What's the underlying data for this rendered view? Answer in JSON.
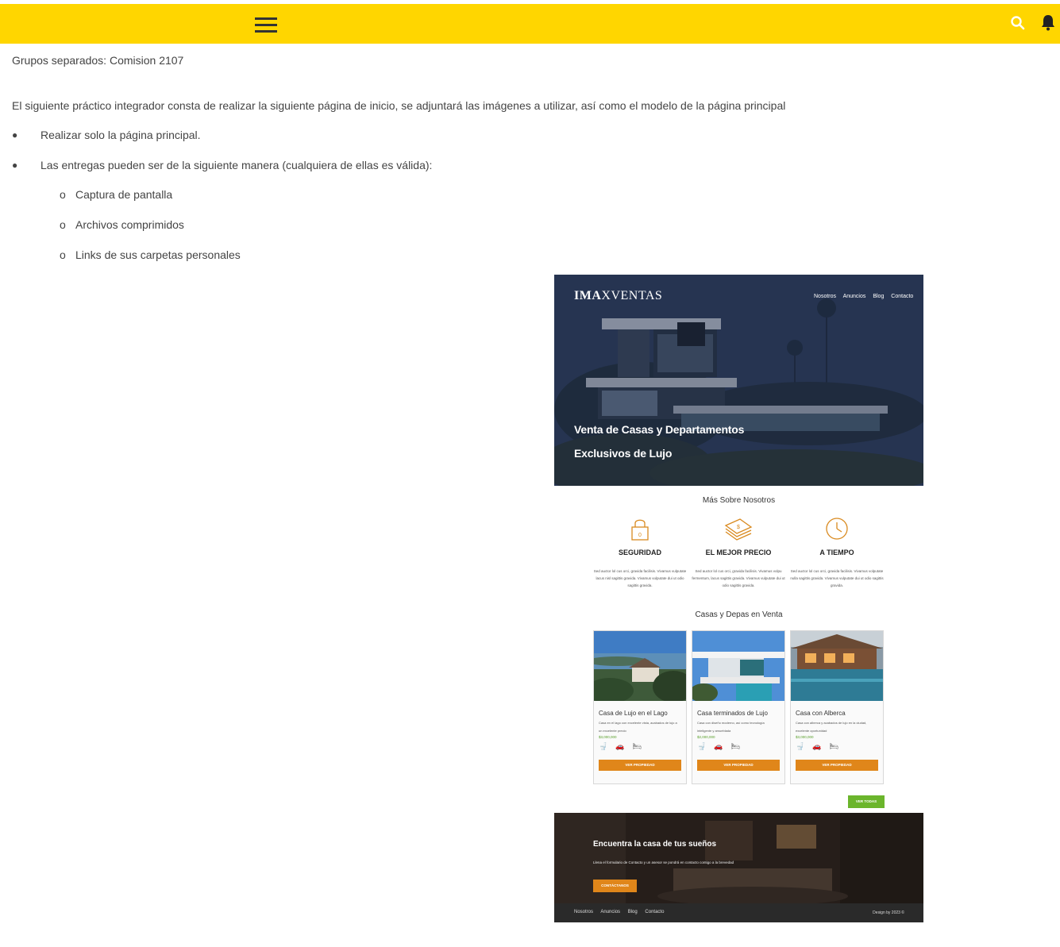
{
  "toolbar": {
    "menu_icon": "hamburger-menu-icon",
    "search_icon": "search-icon",
    "bell_icon": "bell-icon",
    "accent": "#ffd600"
  },
  "doc": {
    "groups_line": "Grupos separados: Comision 2107",
    "intro": "El siguiente práctico integrador consta de realizar la siguiente página de inicio, se adjuntará las imágenes a utilizar, así como el modelo de la página principal",
    "bullets": [
      "Realizar solo la página principal.",
      "Las entregas pueden ser de la siguiente manera (cualquiera de ellas es válida):"
    ],
    "sub_marker": "o",
    "sub_items": [
      "Captura de pantalla",
      "Archivos comprimidos",
      "Links de sus carpetas personales"
    ]
  },
  "mock": {
    "logo_bold": "IMA",
    "logo_rest": "XVENTAS",
    "nav": [
      "Nosotros",
      "Anuncios",
      "Blog",
      "Contacto"
    ],
    "hero_title_1": "Venta de Casas y Departamentos",
    "hero_title_2": "Exclusivos de Lujo",
    "about_title": "Más Sobre Nosotros",
    "features": [
      {
        "icon": "lock-icon",
        "title": "SEGURIDAD",
        "text": "Sed auctor lol cus orci, gravida facilisis. Vivamus vulputate lacus nisl sagittis gravida. Vivamus vulputate dui ut odio sagittis gravida."
      },
      {
        "icon": "money-icon",
        "title": "EL MEJOR PRECIO",
        "text": "Sed auctor lol cus orci, gravida facilisis. Vivamus volpu fermentum, lacus sagittis gravida. Vivamus vulputate dui ut odio sagittis gravida."
      },
      {
        "icon": "clock-icon",
        "title": "A TIEMPO",
        "text": "Sed auctor lol cus orci, gravida facilisis. Vivamus volputate nulla sagittis gravida. Vivamus vulputate dui ut odio sagittis gravida."
      }
    ],
    "listings_title": "Casas y Depas en Venta",
    "cards": [
      {
        "title": "Casa de Lujo en el Lago",
        "desc": "Casa en el lago con excelente vista, acabados de lujo a un excelente precio",
        "price": "$3,000,000",
        "button": "VER PROPIEDAD"
      },
      {
        "title": "Casa terminados de Lujo",
        "desc": "Casa con diseño moderno, así como tecnología inteligente y amueblada",
        "price": "$2,000,000",
        "button": "VER PROPIEDAD"
      },
      {
        "title": "Casa con Alberca",
        "desc": "Casa con alberca y acabados de lujo en la ciudad, excelente oportunidad",
        "price": "$3,000,000",
        "button": "VER PROPIEDAD"
      }
    ],
    "ver_todas": "VER TODAS",
    "cta_title": "Encuentra la casa de tus sueños",
    "cta_text": "Llena el formulario de Contacto y un asesor se pondrá en contacto contigo a la brevedad",
    "cta_button": "CONTÁCTANOS",
    "footer_nav": [
      "Nosotros",
      "Anuncios",
      "Blog",
      "Contacto"
    ],
    "footer_copy": "Design by 2023 ©",
    "colors": {
      "orange": "#e0861a",
      "green": "#6bb52c",
      "hero_overlay": "#2b3a56"
    }
  }
}
